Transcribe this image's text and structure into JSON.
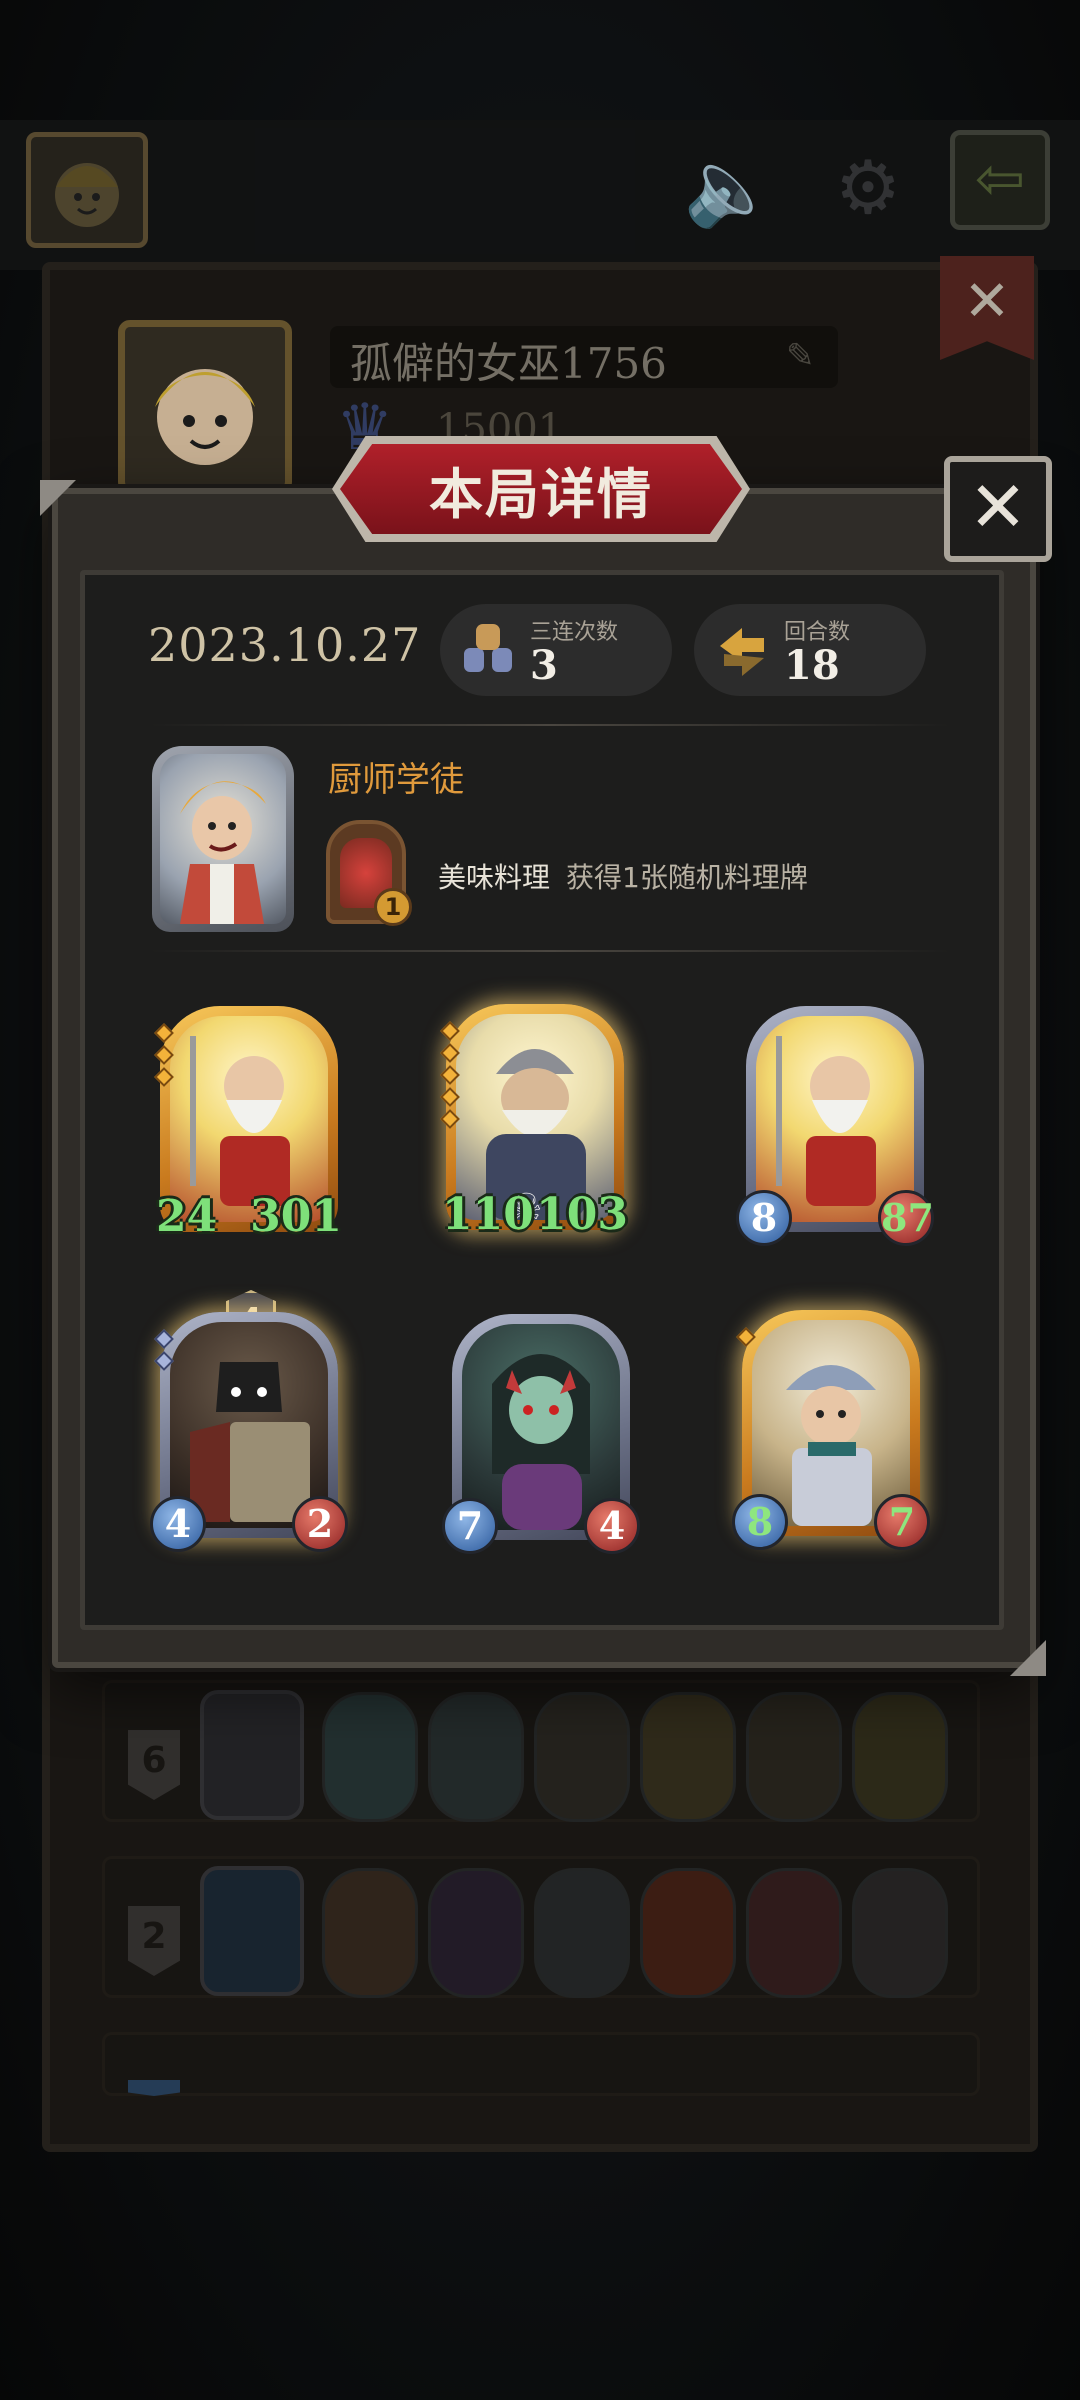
{
  "background": {
    "player_name": "孤僻的女巫1756",
    "score": "15001",
    "row_badges": [
      "6",
      "2",
      ""
    ]
  },
  "modal": {
    "title": "本局详情",
    "date": "2023.10.27",
    "stats": [
      {
        "label": "三连次数",
        "value": "3",
        "icon": "triple-merge-icon"
      },
      {
        "label": "回合数",
        "value": "18",
        "icon": "rounds-arrows-icon"
      }
    ],
    "hero": {
      "name": "厨师学徒",
      "skill_level": "1",
      "skill_name": "美味料理",
      "skill_desc": "获得1张随机料理牌"
    },
    "cards": [
      {
        "attack": "24",
        "health": "301",
        "frame": "gold",
        "style": "plain"
      },
      {
        "attack": "110",
        "health": "103",
        "frame": "gold",
        "style": "plain"
      },
      {
        "attack": "8",
        "health": "87",
        "frame": "silver",
        "style": "orb"
      },
      {
        "attack": "4",
        "health": "2",
        "frame": "silver",
        "style": "orb",
        "badge": "4"
      },
      {
        "attack": "7",
        "health": "4",
        "frame": "silver",
        "style": "orb"
      },
      {
        "attack": "8",
        "health": "7",
        "frame": "gold",
        "style": "orb"
      }
    ]
  },
  "colors": {
    "title_red": "#9a1820",
    "hero_name": "#e09a3c",
    "stat_green": "#7ee07a"
  }
}
